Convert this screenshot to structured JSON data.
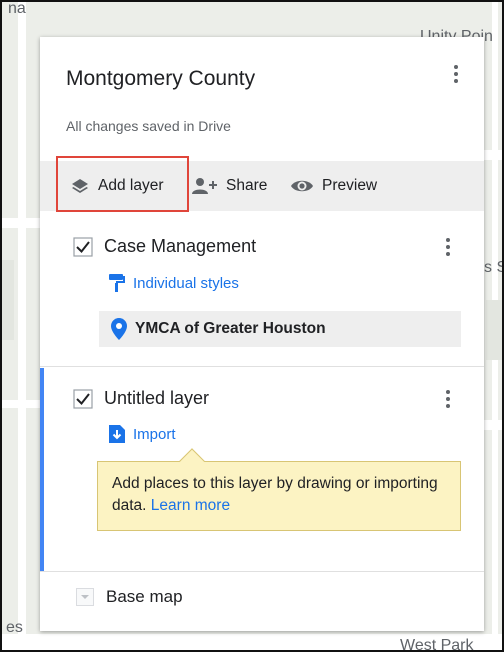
{
  "map": {
    "labels": [
      "na",
      "Unity Poin",
      "s S",
      "es",
      "West Park"
    ]
  },
  "panel": {
    "title": "Montgomery County",
    "save_status": "All changes saved in Drive",
    "toolbar": {
      "add_layer_label": "Add layer",
      "share_label": "Share",
      "preview_label": "Preview"
    },
    "layers": [
      {
        "title": "Case Management",
        "checked": true,
        "style_link": "Individual styles",
        "places": [
          "YMCA of Greater Houston"
        ]
      },
      {
        "title": "Untitled layer",
        "checked": true,
        "import_link": "Import",
        "tooltip": {
          "text": "Add places to this layer by drawing or importing data.",
          "link": "Learn more"
        }
      }
    ],
    "base_map_label": "Base map"
  },
  "colors": {
    "accent": "#1a73e8",
    "active_layer_bar": "#4285f4",
    "highlight": "#e0453a",
    "tooltip_bg": "#fcf3c3"
  },
  "icons": [
    "layers-icon",
    "add-person-icon",
    "eye-icon",
    "checkbox-checked-icon",
    "paint-roller-icon",
    "map-pin-icon",
    "import-icon",
    "more-vert-icon",
    "dropdown-arrow-icon"
  ]
}
